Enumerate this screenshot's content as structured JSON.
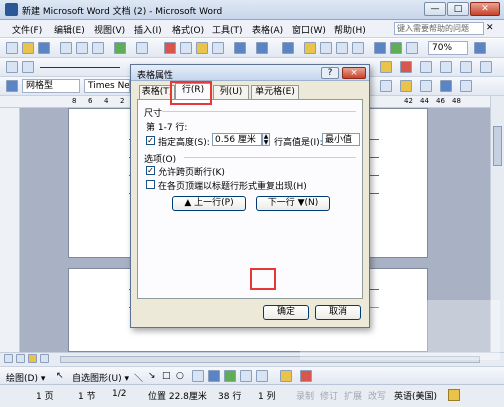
{
  "window": {
    "title": "新建 Microsoft Word 文档 (2) - Microsoft Word"
  },
  "menu": [
    "文件(F)",
    "编辑(E)",
    "视图(V)",
    "插入(I)",
    "格式(O)",
    "工具(T)",
    "表格(A)",
    "窗口(W)",
    "帮助(H)"
  ],
  "search_placeholder": "键入需要帮助的问题",
  "toolbar": {
    "zoom": "70%",
    "style": "网格型",
    "font": "Times New"
  },
  "ruler_ticks": [
    "8",
    "6",
    "4",
    "2",
    "42",
    "44",
    "46",
    "48"
  ],
  "dialog": {
    "title": "表格属性",
    "help": "?",
    "close": "×",
    "tabs": [
      "表格(T)",
      "行(R)",
      "列(U)",
      "单元格(E)"
    ],
    "active_tab": 1,
    "size_group": "尺寸",
    "row_range": "第 1-7 行:",
    "specify_height_label": "指定高度(S):",
    "specify_height_checked": true,
    "height_value": "0.56 厘米",
    "row_height_is_label": "行高值是(I):",
    "row_height_mode": "最小值",
    "options_group": "选项(O)",
    "allow_break_label": "允许跨页断行(K)",
    "allow_break_checked": true,
    "repeat_header_label": "在各页顶端以标题行形式重复出现(H)",
    "repeat_header_checked": false,
    "prev_row": "▲ 上一行(P)",
    "next_row": "下一行 ▼(N)",
    "ok": "确定",
    "cancel": "取消"
  },
  "drawbar": {
    "draw": "绘图(D) ▾",
    "autoshapes": "自选图形(U) ▾"
  },
  "status": {
    "page": "1 页",
    "section": "1 节",
    "page_of": "1/2",
    "position": "位置 22.8厘米",
    "line": "38 行",
    "column": "1 列",
    "rec": "录制",
    "trk": "修订",
    "ext": "扩展",
    "ovr": "改写",
    "language": "英语(美国)"
  }
}
